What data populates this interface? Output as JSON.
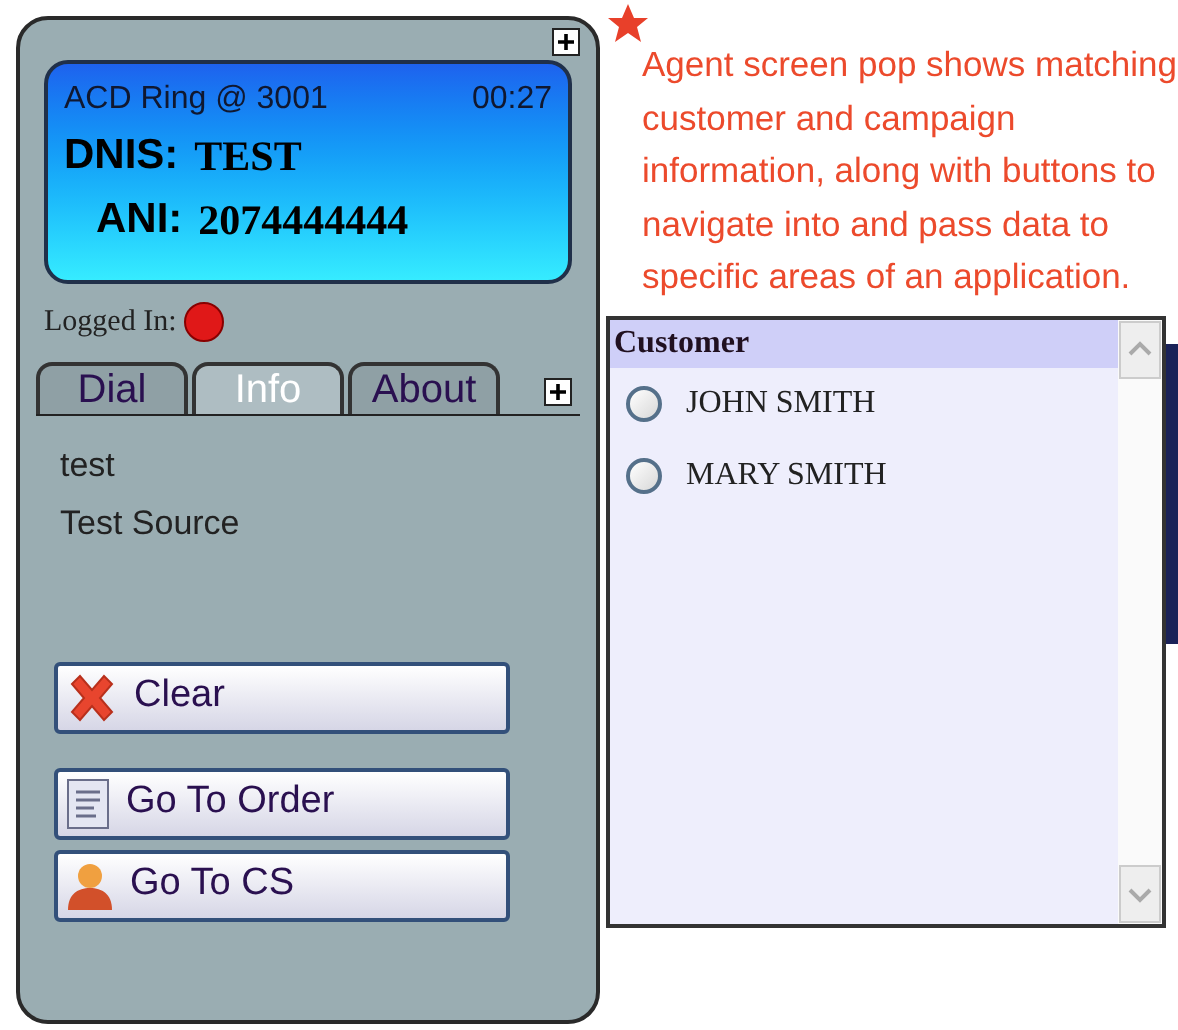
{
  "agent_panel": {
    "display": {
      "line": "ACD Ring @ 3001",
      "timer": "00:27",
      "dnis_label": "DNIS:",
      "dnis_value": "TEST",
      "ani_label": "ANI:",
      "ani_value": "2074444444"
    },
    "status": {
      "label": "Logged In:",
      "color": "#e01818"
    },
    "tabs": [
      {
        "label": "Dial",
        "selected": false
      },
      {
        "label": "Info",
        "selected": true
      },
      {
        "label": "About",
        "selected": false
      }
    ],
    "info_lines": [
      "test",
      "Test Source"
    ],
    "buttons": [
      {
        "label": "Clear",
        "kind": "clear"
      },
      {
        "label": "Go To Order",
        "kind": "order"
      },
      {
        "label": "Go To CS",
        "kind": "person"
      }
    ]
  },
  "annotation": "Agent screen pop shows matching customer and campaign information, along with buttons to navigate into and pass data to specific areas of  an application.",
  "customer_list": {
    "header": "Customer",
    "options": [
      {
        "label": "JOHN SMITH",
        "selected": false
      },
      {
        "label": "MARY SMITH",
        "selected": false
      }
    ]
  }
}
